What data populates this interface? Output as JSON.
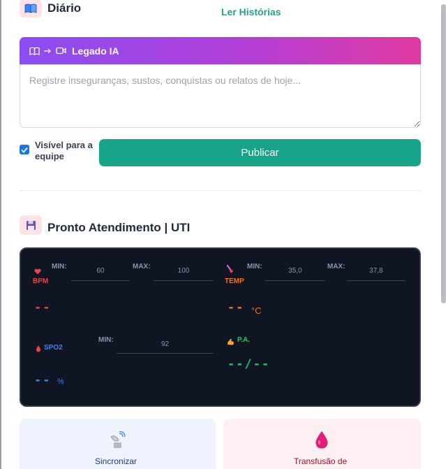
{
  "header": {
    "title": "Diário",
    "read_stories_link": "Ler Histórias",
    "icon": "open-book-icon"
  },
  "legado": {
    "label": "Legado IA",
    "icons": [
      "book-icon",
      "arrow-right-icon",
      "video-camera-icon"
    ],
    "gradient": [
      "#8b4df2",
      "#e03aa1"
    ]
  },
  "entry": {
    "placeholder": "Registre inseguranças, sustos, conquistas ou relatos de hoje...",
    "value": ""
  },
  "visibility": {
    "label": "Visível para a equipe",
    "checked": true
  },
  "publish_button": "Publicar",
  "pronto": {
    "title": "Pronto Atendimento | UTI",
    "icon": "floppy-disk-icon"
  },
  "monitor": {
    "bpm": {
      "label": "BPM",
      "icon": "heart-icon",
      "min_label": "MIN:",
      "min": "60",
      "max_label": "MAX:",
      "max": "100",
      "value": "--",
      "color": "#ef4444"
    },
    "temp": {
      "label": "TEMP",
      "icon": "thermometer-icon",
      "min_label": "MIN:",
      "min": "35,0",
      "max_label": "MAX:",
      "max": "37,8",
      "value": "--",
      "unit": "°C",
      "color": "#f97316"
    },
    "spo2": {
      "label": "SPO2",
      "icon": "blood-drop-icon",
      "min_label": "MIN:",
      "min": "92",
      "value": "--",
      "unit": "%",
      "color": "#3b82f6"
    },
    "pa": {
      "label": "P.A.",
      "icon": "flexed-arm-icon",
      "value": "--/--",
      "color": "#22c55e"
    }
  },
  "cards": [
    {
      "label": "Sincronizar",
      "icon": "satellite-dish-icon"
    },
    {
      "label": "Transfusão de",
      "icon": "blood-drop-icon"
    }
  ],
  "colors": {
    "accent": "#18a488",
    "link": "#1fa38b",
    "monitor_bg": "#0f1522"
  }
}
